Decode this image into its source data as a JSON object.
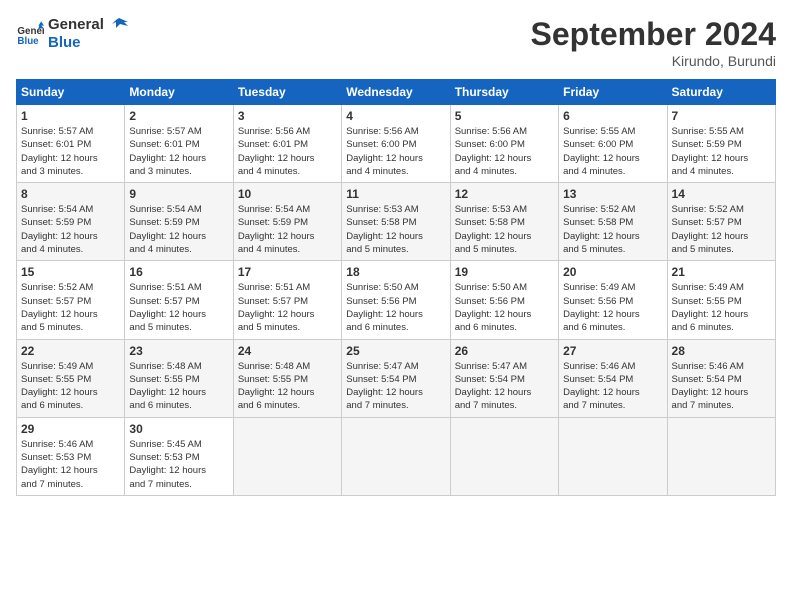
{
  "header": {
    "logo": {
      "line1": "General",
      "line2": "Blue"
    },
    "title": "September 2024",
    "location": "Kirundo, Burundi"
  },
  "weekdays": [
    "Sunday",
    "Monday",
    "Tuesday",
    "Wednesday",
    "Thursday",
    "Friday",
    "Saturday"
  ],
  "weeks": [
    [
      {
        "day": "1",
        "info": "Sunrise: 5:57 AM\nSunset: 6:01 PM\nDaylight: 12 hours\nand 3 minutes."
      },
      {
        "day": "2",
        "info": "Sunrise: 5:57 AM\nSunset: 6:01 PM\nDaylight: 12 hours\nand 3 minutes."
      },
      {
        "day": "3",
        "info": "Sunrise: 5:56 AM\nSunset: 6:01 PM\nDaylight: 12 hours\nand 4 minutes."
      },
      {
        "day": "4",
        "info": "Sunrise: 5:56 AM\nSunset: 6:00 PM\nDaylight: 12 hours\nand 4 minutes."
      },
      {
        "day": "5",
        "info": "Sunrise: 5:56 AM\nSunset: 6:00 PM\nDaylight: 12 hours\nand 4 minutes."
      },
      {
        "day": "6",
        "info": "Sunrise: 5:55 AM\nSunset: 6:00 PM\nDaylight: 12 hours\nand 4 minutes."
      },
      {
        "day": "7",
        "info": "Sunrise: 5:55 AM\nSunset: 5:59 PM\nDaylight: 12 hours\nand 4 minutes."
      }
    ],
    [
      {
        "day": "8",
        "info": "Sunrise: 5:54 AM\nSunset: 5:59 PM\nDaylight: 12 hours\nand 4 minutes."
      },
      {
        "day": "9",
        "info": "Sunrise: 5:54 AM\nSunset: 5:59 PM\nDaylight: 12 hours\nand 4 minutes."
      },
      {
        "day": "10",
        "info": "Sunrise: 5:54 AM\nSunset: 5:59 PM\nDaylight: 12 hours\nand 4 minutes."
      },
      {
        "day": "11",
        "info": "Sunrise: 5:53 AM\nSunset: 5:58 PM\nDaylight: 12 hours\nand 5 minutes."
      },
      {
        "day": "12",
        "info": "Sunrise: 5:53 AM\nSunset: 5:58 PM\nDaylight: 12 hours\nand 5 minutes."
      },
      {
        "day": "13",
        "info": "Sunrise: 5:52 AM\nSunset: 5:58 PM\nDaylight: 12 hours\nand 5 minutes."
      },
      {
        "day": "14",
        "info": "Sunrise: 5:52 AM\nSunset: 5:57 PM\nDaylight: 12 hours\nand 5 minutes."
      }
    ],
    [
      {
        "day": "15",
        "info": "Sunrise: 5:52 AM\nSunset: 5:57 PM\nDaylight: 12 hours\nand 5 minutes."
      },
      {
        "day": "16",
        "info": "Sunrise: 5:51 AM\nSunset: 5:57 PM\nDaylight: 12 hours\nand 5 minutes."
      },
      {
        "day": "17",
        "info": "Sunrise: 5:51 AM\nSunset: 5:57 PM\nDaylight: 12 hours\nand 5 minutes."
      },
      {
        "day": "18",
        "info": "Sunrise: 5:50 AM\nSunset: 5:56 PM\nDaylight: 12 hours\nand 6 minutes."
      },
      {
        "day": "19",
        "info": "Sunrise: 5:50 AM\nSunset: 5:56 PM\nDaylight: 12 hours\nand 6 minutes."
      },
      {
        "day": "20",
        "info": "Sunrise: 5:49 AM\nSunset: 5:56 PM\nDaylight: 12 hours\nand 6 minutes."
      },
      {
        "day": "21",
        "info": "Sunrise: 5:49 AM\nSunset: 5:55 PM\nDaylight: 12 hours\nand 6 minutes."
      }
    ],
    [
      {
        "day": "22",
        "info": "Sunrise: 5:49 AM\nSunset: 5:55 PM\nDaylight: 12 hours\nand 6 minutes."
      },
      {
        "day": "23",
        "info": "Sunrise: 5:48 AM\nSunset: 5:55 PM\nDaylight: 12 hours\nand 6 minutes."
      },
      {
        "day": "24",
        "info": "Sunrise: 5:48 AM\nSunset: 5:55 PM\nDaylight: 12 hours\nand 6 minutes."
      },
      {
        "day": "25",
        "info": "Sunrise: 5:47 AM\nSunset: 5:54 PM\nDaylight: 12 hours\nand 7 minutes."
      },
      {
        "day": "26",
        "info": "Sunrise: 5:47 AM\nSunset: 5:54 PM\nDaylight: 12 hours\nand 7 minutes."
      },
      {
        "day": "27",
        "info": "Sunrise: 5:46 AM\nSunset: 5:54 PM\nDaylight: 12 hours\nand 7 minutes."
      },
      {
        "day": "28",
        "info": "Sunrise: 5:46 AM\nSunset: 5:54 PM\nDaylight: 12 hours\nand 7 minutes."
      }
    ],
    [
      {
        "day": "29",
        "info": "Sunrise: 5:46 AM\nSunset: 5:53 PM\nDaylight: 12 hours\nand 7 minutes."
      },
      {
        "day": "30",
        "info": "Sunrise: 5:45 AM\nSunset: 5:53 PM\nDaylight: 12 hours\nand 7 minutes."
      },
      {
        "day": "",
        "info": ""
      },
      {
        "day": "",
        "info": ""
      },
      {
        "day": "",
        "info": ""
      },
      {
        "day": "",
        "info": ""
      },
      {
        "day": "",
        "info": ""
      }
    ]
  ]
}
